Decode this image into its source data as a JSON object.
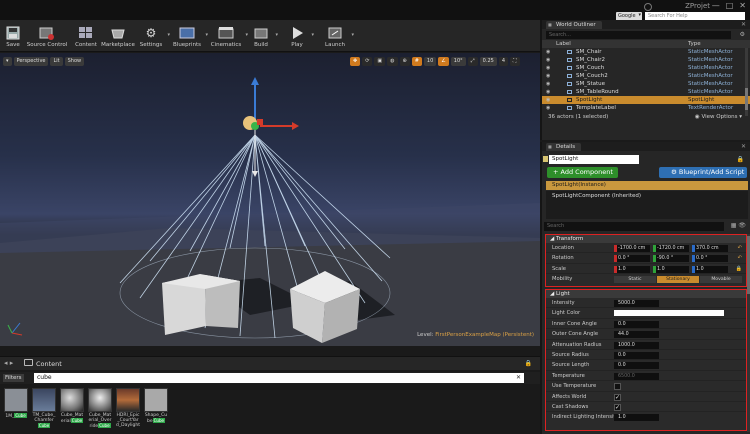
{
  "window": {
    "project": "ZProjet",
    "google_label": "Google",
    "help_placeholder": "Search For Help",
    "min": "—",
    "max": "□",
    "close": "✕"
  },
  "toolbar": [
    {
      "label": "Save",
      "icon": "save-icon"
    },
    {
      "label": "Source Control",
      "icon": "source-control-icon"
    },
    {
      "label": "Content",
      "icon": "content-icon"
    },
    {
      "label": "Marketplace",
      "icon": "marketplace-icon"
    },
    {
      "label": "Settings",
      "icon": "settings-icon"
    },
    {
      "label": "Blueprints",
      "icon": "blueprints-icon"
    },
    {
      "label": "Cinematics",
      "icon": "cinematics-icon"
    },
    {
      "label": "Build",
      "icon": "build-icon"
    },
    {
      "label": "Play",
      "icon": "play-icon"
    },
    {
      "label": "Launch",
      "icon": "launch-icon"
    }
  ],
  "viewport": {
    "perspective": "Perspective",
    "lit": "Lit",
    "show": "Show",
    "snap_grid": "10",
    "snap_rot": "10°",
    "snap_scale": "0.25",
    "camera_speed": "4",
    "level_label": "Level:",
    "level_name": "FirstPersonExampleMap (Persistent)"
  },
  "content_browser": {
    "title": "Content",
    "filters_label": "Filters",
    "search_value": "cube",
    "assets": [
      {
        "name": "1M_",
        "tag": "Cube"
      },
      {
        "name": "TM_Cube_Chamfer",
        "tag": "Cube"
      },
      {
        "name": "Cube_Material",
        "tag": "Cube"
      },
      {
        "name": "Cube_Material_Override",
        "tag": "Cube"
      },
      {
        "name": "HDRI_Epic_CourtYard_Daylight",
        "tag": ""
      },
      {
        "name": "Shape_Cube",
        "tag": "Cube"
      }
    ]
  },
  "world_outliner": {
    "title": "World Outliner",
    "search_placeholder": "Search...",
    "col_label": "Label",
    "col_type": "Type",
    "rows": [
      {
        "name": "SM_Chair",
        "type": "StaticMeshActor",
        "selected": false
      },
      {
        "name": "SM_Chair2",
        "type": "StaticMeshActor",
        "selected": false
      },
      {
        "name": "SM_Couch",
        "type": "StaticMeshActor",
        "selected": false
      },
      {
        "name": "SM_Couch2",
        "type": "StaticMeshActor",
        "selected": false
      },
      {
        "name": "SM_Statue",
        "type": "StaticMeshActor",
        "selected": false
      },
      {
        "name": "SM_TableRound",
        "type": "StaticMeshActor",
        "selected": false
      },
      {
        "name": "SpotLight",
        "type": "SpotLight",
        "selected": true
      },
      {
        "name": "TemplateLabel",
        "type": "TextRenderActor",
        "selected": false
      }
    ],
    "actor_count": "36 actors (1 selected)",
    "view_options": "View Options"
  },
  "details": {
    "title": "Details",
    "name_value": "SpotLight",
    "add_component": "+ Add Component",
    "blueprint_script": "Blueprint/Add Script",
    "instance_label": "SpotLight(Instance)",
    "component_label": "SpotLightComponent (Inherited)",
    "search_placeholder": "Search",
    "transform": {
      "title": "Transform",
      "location_label": "Location",
      "location": [
        "-1700.0 cm",
        "-1720.0 cm",
        "370.0 cm"
      ],
      "rotation_label": "Rotation",
      "rotation": [
        "0.0 °",
        "-90.0 °",
        "0.0 °"
      ],
      "scale_label": "Scale",
      "scale": [
        "1.0",
        "1.0",
        "1.0"
      ],
      "mobility_label": "Mobility",
      "mobility": [
        "Static",
        "Stationary",
        "Movable"
      ],
      "mobility_selected": 1
    },
    "light": {
      "title": "Light",
      "intensity_label": "Intensity",
      "intensity": "5000.0",
      "color_label": "Light Color",
      "light_color": "#ffffff",
      "inner_label": "Inner Cone Angle",
      "inner": "0.0",
      "outer_label": "Outer Cone Angle",
      "outer": "44.0",
      "atten_label": "Attenuation Radius",
      "atten": "1000.0",
      "radius_label": "Source Radius",
      "radius": "0.0",
      "length_label": "Source Length",
      "length": "0.0",
      "temp_label": "Temperature",
      "temp": "6500.0",
      "usetemp_label": "Use Temperature",
      "usetemp": false,
      "affects_label": "Affects World",
      "affects": true,
      "shadows_label": "Cast Shadows",
      "shadows": true,
      "indirect_label": "Indirect Lighting Intensity",
      "indirect": "1.0"
    }
  },
  "colors": {
    "selection": "#c98b2d",
    "highlight_border": "#dd2222",
    "add_component": "#2e8f2a",
    "blueprint": "#2e6fb3"
  }
}
